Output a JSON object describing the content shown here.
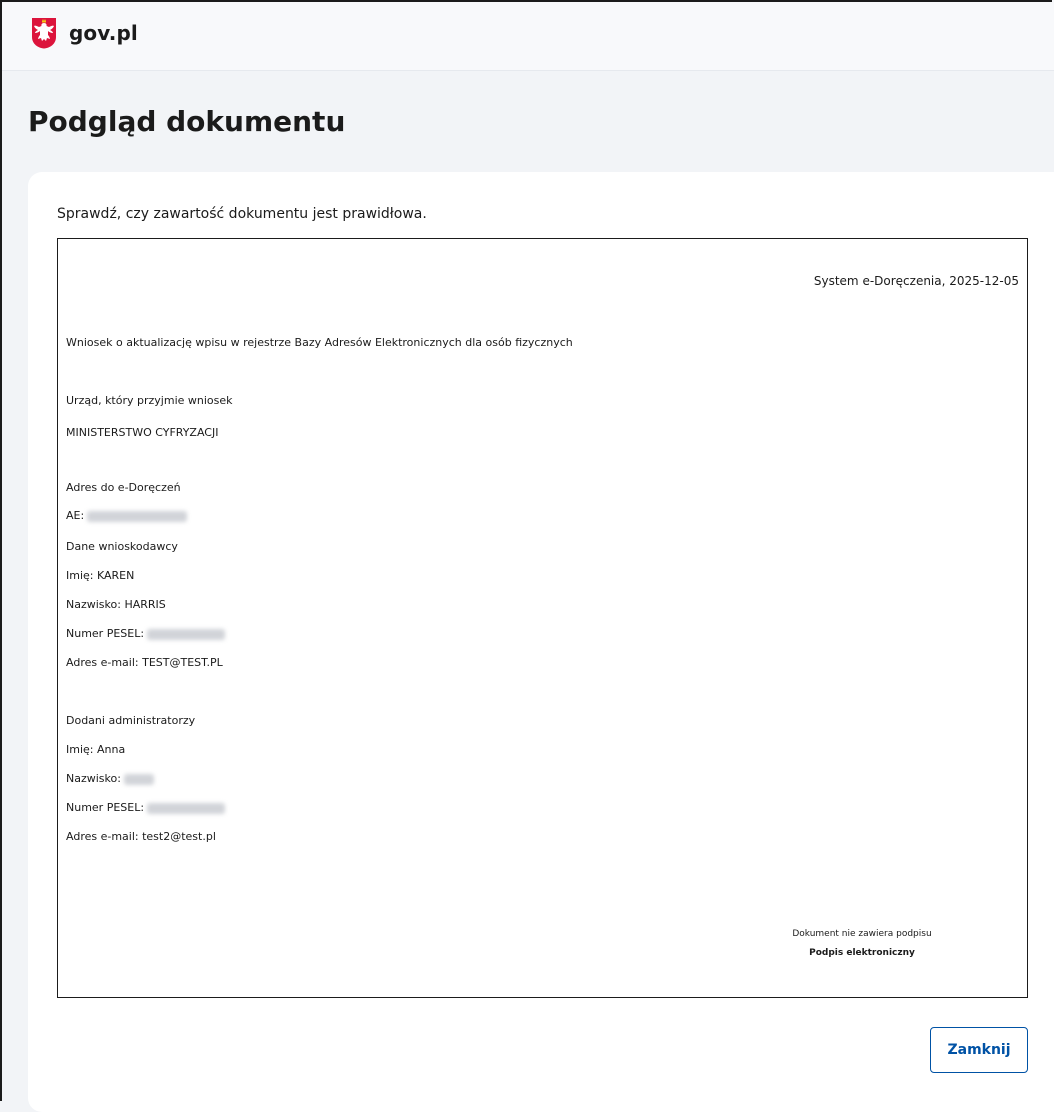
{
  "header": {
    "logo_text": "gov.pl",
    "logo_icon": "polish-eagle-emblem-icon"
  },
  "page": {
    "title": "Podgląd dokumentu",
    "instruction": "Sprawdź, czy zawartość dokumentu jest prawidłowa."
  },
  "document": {
    "system_date": "System e-Doręczenia, 2025-12-05",
    "request_title": "Wniosek o aktualizację wpisu w rejestrze Bazy Adresów Elektronicznych dla osób fizycznych",
    "office_label": "Urząd, który przyjmie wniosek",
    "office_value": "MINISTERSTWO CYFRYZACJI",
    "address_label": "Adres do e-Doręczeń",
    "ae_label": "AE:",
    "applicant_label": "Dane wnioskodawcy",
    "applicant_name": "Imię: KAREN",
    "applicant_surname": "Nazwisko: HARRIS",
    "applicant_pesel_label": "Numer PESEL:",
    "applicant_email": "Adres e-mail: TEST@TEST.PL",
    "admins_label": "Dodani administratorzy",
    "admin_name": "Imię: Anna",
    "admin_surname_label": "Nazwisko:",
    "admin_pesel_label": "Numer PESEL:",
    "admin_email": "Adres e-mail: test2@test.pl",
    "signature_note": "Dokument nie zawiera podpisu",
    "signature_label": "Podpis elektroniczny"
  },
  "actions": {
    "close_label": "Zamknij"
  }
}
